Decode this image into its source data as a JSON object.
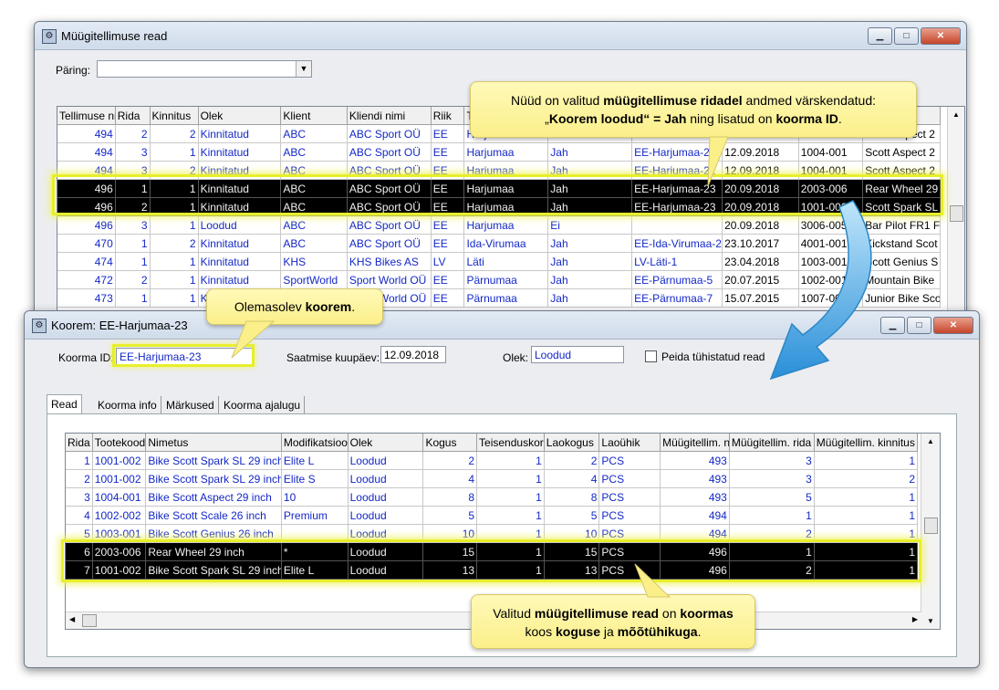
{
  "top": {
    "title": "Müügitellimuse read",
    "query_label": "Päring:",
    "query_value": "",
    "columns": [
      "Tellimuse nr",
      "Rida",
      "Kinnitus",
      "Olek",
      "Klient",
      "Kliendi nimi",
      "Riik",
      "Tr",
      "",
      "",
      "",
      "",
      ""
    ],
    "rows": [
      [
        "494",
        "2",
        "2",
        "Kinnitatud",
        "ABC",
        "ABC Sport OÜ",
        "EE",
        "Harjumaa",
        "",
        "",
        "",
        "",
        "Scott Aspect 2"
      ],
      [
        "494",
        "3",
        "1",
        "Kinnitatud",
        "ABC",
        "ABC Sport OÜ",
        "EE",
        "Harjumaa",
        "Jah",
        "EE-Harjumaa-22",
        "12.09.2018",
        "1004-001",
        "Scott Aspect 2"
      ],
      [
        "494",
        "3",
        "2",
        "Kinnitatud",
        "ABC",
        "ABC Sport OÜ",
        "EE",
        "Harjumaa",
        "Jah",
        "EE-Harjumaa-22",
        "12.09.2018",
        "1004-001",
        "Scott Aspect 2"
      ],
      [
        "496",
        "1",
        "1",
        "Kinnitatud",
        "ABC",
        "ABC Sport OÜ",
        "EE",
        "Harjumaa",
        "Jah",
        "EE-Harjumaa-23",
        "20.09.2018",
        "2003-006",
        "Rear Wheel 29"
      ],
      [
        "496",
        "2",
        "1",
        "Kinnitatud",
        "ABC",
        "ABC Sport OÜ",
        "EE",
        "Harjumaa",
        "Jah",
        "EE-Harjumaa-23",
        "20.09.2018",
        "1001-002",
        "Scott Spark SL"
      ],
      [
        "496",
        "3",
        "1",
        "Loodud",
        "ABC",
        "ABC Sport OÜ",
        "EE",
        "Harjumaa",
        "Ei",
        "",
        "20.09.2018",
        "3006-005",
        "Bar Pilot FR1 F"
      ],
      [
        "470",
        "1",
        "2",
        "Kinnitatud",
        "ABC",
        "ABC Sport OÜ",
        "EE",
        "Ida-Virumaa",
        "Jah",
        "EE-Ida-Virumaa-2",
        "23.10.2017",
        "4001-001",
        "Kickstand Scot"
      ],
      [
        "474",
        "1",
        "1",
        "Kinnitatud",
        "KHS",
        "KHS Bikes AS",
        "LV",
        "Läti",
        "Jah",
        "LV-Läti-1",
        "23.04.2018",
        "1003-001",
        "Scott Genius S"
      ],
      [
        "472",
        "2",
        "1",
        "Kinnitatud",
        "SportWorld",
        "Sport World OÜ",
        "EE",
        "Pärnumaa",
        "Jah",
        "EE-Pärnumaa-5",
        "20.07.2015",
        "1002-001",
        "Mountain Bike"
      ],
      [
        "473",
        "1",
        "1",
        "Kinnitatud",
        "SportWorld",
        "Sport World OÜ",
        "EE",
        "Pärnumaa",
        "Jah",
        "EE-Pärnumaa-7",
        "15.07.2015",
        "1007-001",
        "Junior Bike Sco"
      ]
    ]
  },
  "callout_top": {
    "t1": "Nüüd on valitud ",
    "b1": "müügitellimuse ridadel",
    "t2": " andmed värskendatud:",
    "t3": "„",
    "b2": "Koorem loodud",
    "t4": "“ = ",
    "b3": "Jah",
    "t5": " ning lisatud on ",
    "b4": "koorma ID",
    "t6": "."
  },
  "callout_mid": {
    "t1": "Olemasolev ",
    "b1": "koorem",
    "t2": "."
  },
  "callout_bottom": {
    "t1": "Valitud ",
    "b1": "müügitellimuse read",
    "t2": " on ",
    "b2": "koormas",
    "t3": "koos ",
    "b3": "koguse",
    "t4": " ja ",
    "b4": "mõõtühikuga",
    "t5": "."
  },
  "bottom": {
    "title": "Koorem: EE-Harjumaa-23",
    "load_id_label": "Koorma ID:",
    "load_id_value": "EE-Harjumaa-23",
    "ship_date_label": "Saatmise kuupäev:",
    "ship_date_value": "12.09.2018",
    "status_label": "Olek:",
    "status_value": "Loodud",
    "hide_label": "Peida tühistatud read",
    "tabs": [
      "Read",
      "Koorma info",
      "Märkused",
      "Koorma ajalugu"
    ],
    "columns": [
      "Rida",
      "Tootekood",
      "Nimetus",
      "Modifikatsioon",
      "Olek",
      "Kogus",
      "Teisenduskordaja",
      "Laokogus",
      "Laoühik",
      "Müügitellim. nr.",
      "Müügitellim. rida",
      "Müügitellim. kinnitus"
    ],
    "rows": [
      [
        "1",
        "1001-002",
        "Bike Scott Spark SL 29 inch",
        "Elite L",
        "Loodud",
        "2",
        "1",
        "2",
        "PCS",
        "493",
        "3",
        "1"
      ],
      [
        "2",
        "1001-002",
        "Bike Scott Spark SL 29 inch",
        "Elite S",
        "Loodud",
        "4",
        "1",
        "4",
        "PCS",
        "493",
        "3",
        "2"
      ],
      [
        "3",
        "1004-001",
        "Bike Scott Aspect 29 inch",
        "10",
        "Loodud",
        "8",
        "1",
        "8",
        "PCS",
        "493",
        "5",
        "1"
      ],
      [
        "4",
        "1002-002",
        "Bike Scott Scale 26 inch",
        "Premium",
        "Loodud",
        "5",
        "1",
        "5",
        "PCS",
        "494",
        "1",
        "1"
      ],
      [
        "5",
        "1003-001",
        "Bike Scott Genius 26 inch",
        "",
        "Loodud",
        "10",
        "1",
        "10",
        "PCS",
        "494",
        "2",
        "1"
      ],
      [
        "6",
        "2003-006",
        "Rear Wheel 29 inch",
        "*",
        "Loodud",
        "15",
        "1",
        "15",
        "PCS",
        "496",
        "1",
        "1"
      ],
      [
        "7",
        "1001-002",
        "Bike Scott Spark SL 29 inch",
        "Elite L",
        "Loodud",
        "13",
        "1",
        "13",
        "PCS",
        "496",
        "2",
        "1"
      ]
    ]
  }
}
